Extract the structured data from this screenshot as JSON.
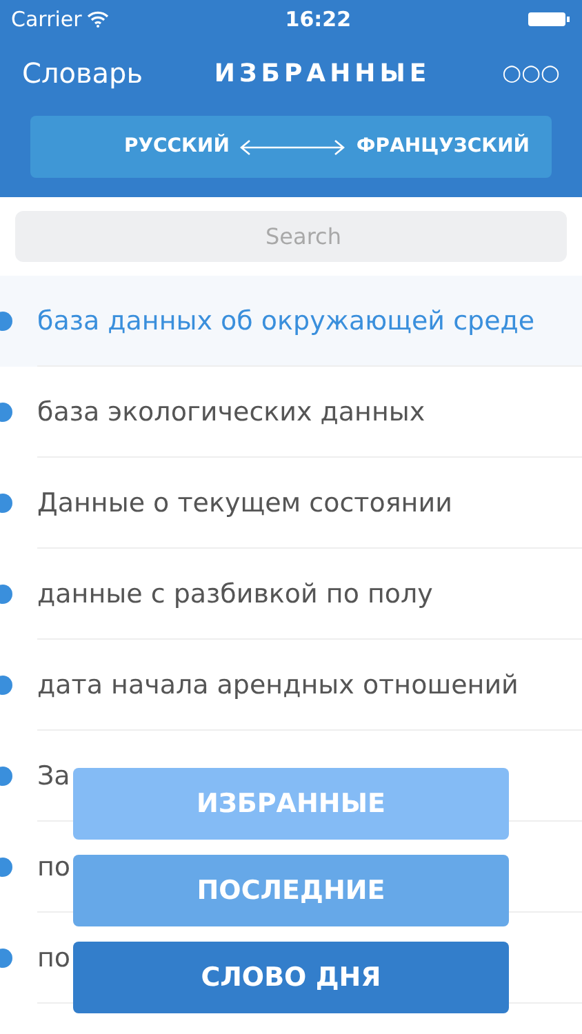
{
  "status_bar": {
    "carrier": "Carrier",
    "time": "16:22"
  },
  "nav": {
    "back": "Словарь",
    "title": "ИЗБРАННЫЕ",
    "more": "○○○"
  },
  "languages": {
    "from": "РУССКИЙ",
    "to": "ФРАНЦУЗСКИЙ"
  },
  "search": {
    "placeholder": "Search"
  },
  "entries": [
    {
      "text": "база данных об окружающей среде",
      "selected": true
    },
    {
      "text": "база экологических данных",
      "selected": false
    },
    {
      "text": "Данные о текущем состоянии",
      "selected": false
    },
    {
      "text": "данные с разбивкой по полу",
      "selected": false
    },
    {
      "text": "дата начала арендных отношений",
      "selected": false
    },
    {
      "text": "За",
      "selected": false
    },
    {
      "text": "по",
      "selected": false
    },
    {
      "text": "по",
      "selected": false
    }
  ],
  "menu": [
    {
      "label": "ИЗБРАННЫЕ",
      "color": "#84bbf5"
    },
    {
      "label": "ПОСЛЕДНИЕ",
      "color": "#66a8e8"
    },
    {
      "label": "СЛОВО ДНЯ",
      "color": "#337ecb"
    }
  ]
}
